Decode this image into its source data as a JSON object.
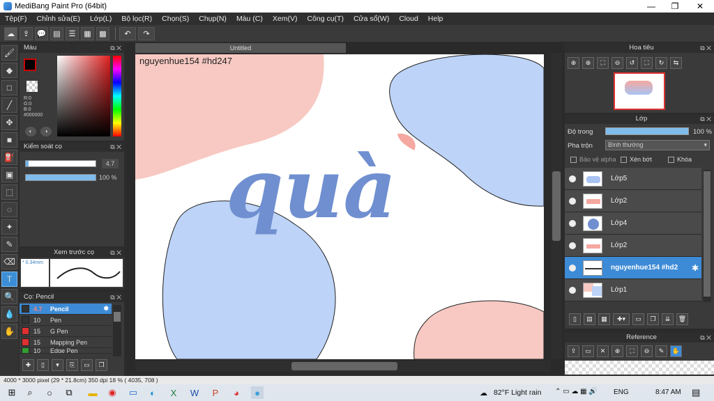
{
  "window": {
    "title": "MediBang Paint Pro (64bit)",
    "min": "—",
    "max": "❐",
    "close": "✕"
  },
  "menu": [
    "Tệp(F)",
    "Chỉnh sửa(E)",
    "Lớp(L)",
    "Bộ lọc(R)",
    "Chọn(S)",
    "Chụp(N)",
    "Màu (C)",
    "Xem(V)",
    "Công cụ(T)",
    "Cửa sổ(W)",
    "Cloud",
    "Help"
  ],
  "panels": {
    "color": "Màu",
    "brush_control": "Kiểm soát cọ",
    "brush_preview": "Xem trước cọ",
    "brush_list": "Cọ: Pencil",
    "navigator": "Hoa tiêu",
    "layer": "Lớp",
    "reference": "Reference"
  },
  "color": {
    "r": "R:0",
    "g": "G:0",
    "b": "B:0",
    "hex": "#000000",
    "fg": "#000000",
    "bg": "#f4a8a0"
  },
  "brush_control": {
    "size": "4.7",
    "opacity": "100 %"
  },
  "brush_preview": {
    "size": "* 0.34mm"
  },
  "brushes": [
    {
      "size": "4.7",
      "name": "Pencil",
      "color": "#333333",
      "selected": true
    },
    {
      "size": "10",
      "name": "Pen",
      "color": "#333333"
    },
    {
      "size": "15",
      "name": "G Pen",
      "color": "#e03030"
    },
    {
      "size": "15",
      "name": "Mapping Pen",
      "color": "#e03030"
    },
    {
      "size": "10",
      "name": "Edge Pen",
      "color": "#30a030"
    }
  ],
  "canvas": {
    "tab": "Untitled",
    "watermark": "nguyenhue154 #hd247",
    "artwork_text": "quà"
  },
  "layer_panel": {
    "opacity_label": "Độ trong",
    "opacity_value": "100 %",
    "blend_label": "Pha trộn",
    "blend_value": "Bình thường",
    "protect_alpha": "Bảo vệ alpha",
    "clipping": "Xén bớt",
    "lock": "Khóa"
  },
  "layers": [
    {
      "name": "Lớp5",
      "selected": false
    },
    {
      "name": "Lớp2",
      "selected": false
    },
    {
      "name": "Lớp4",
      "selected": false
    },
    {
      "name": "Lớp2",
      "selected": false
    },
    {
      "name": "nguyenhue154 #hd2",
      "selected": true
    },
    {
      "name": "Lớp1",
      "selected": false
    }
  ],
  "status": "4000 * 3000 pixel   (29 * 21.8cm)   350 dpi   18 %   ( 4035, 708 )",
  "taskbar": {
    "weather": "82°F  Light rain",
    "lang": "ENG",
    "time": "8:47 AM"
  }
}
